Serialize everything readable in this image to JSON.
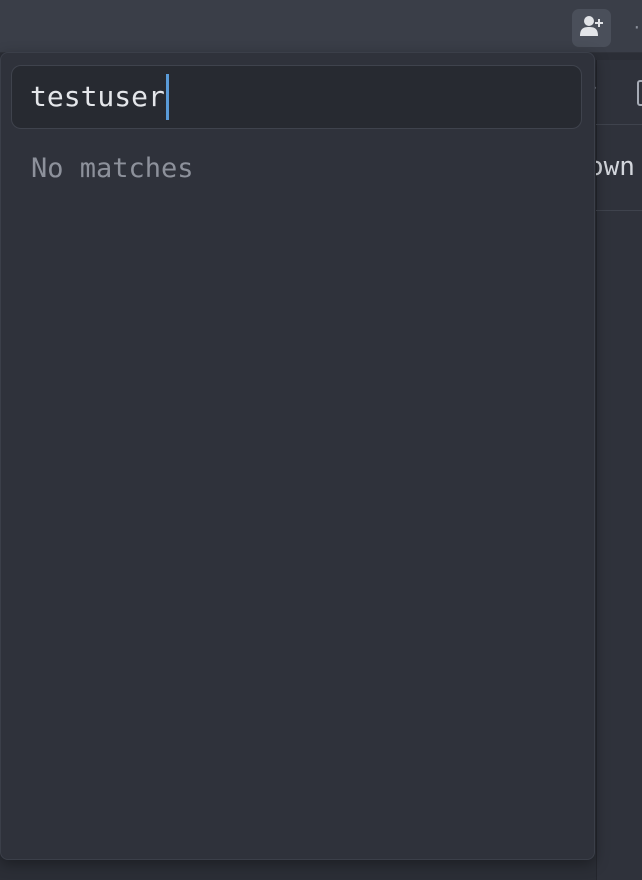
{
  "header": {
    "add_user_icon": "user-plus-icon",
    "more_icon": "more-horizontal-icon",
    "more_glyph": "··"
  },
  "background": {
    "row_text": "own"
  },
  "popover": {
    "search": {
      "value": "testuser"
    },
    "empty_text": "No matches"
  },
  "colors": {
    "caret": "#5a9bd8",
    "background": "#2b2e36",
    "popover": "#2f323b"
  }
}
